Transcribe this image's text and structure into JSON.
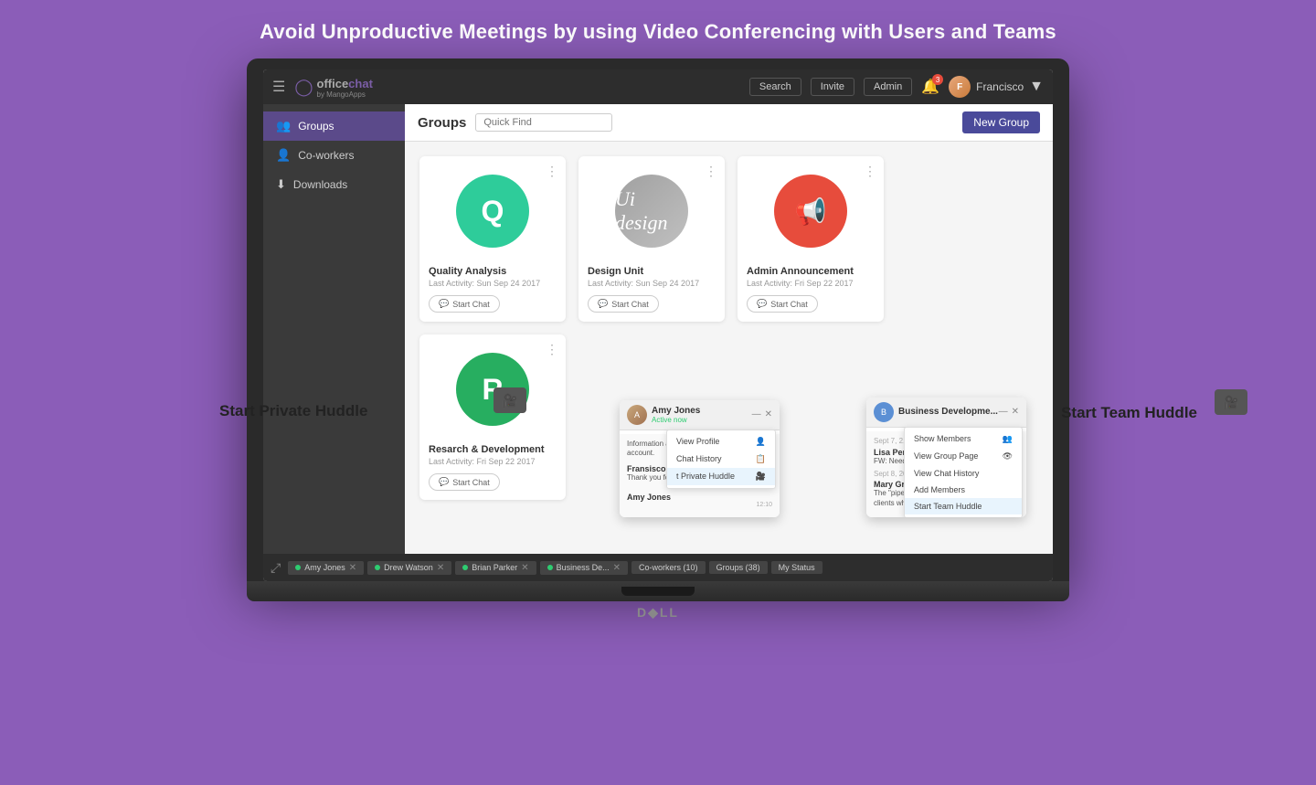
{
  "headline": "Avoid Unproductive Meetings by using Video Conferencing with Users and Teams",
  "nav": {
    "search_label": "Search",
    "invite_label": "Invite",
    "admin_label": "Admin",
    "user_name": "Francisco",
    "logo_office": "office",
    "logo_chat": "chat",
    "logo_sub": "by MangoApps"
  },
  "sidebar": {
    "items": [
      {
        "label": "Groups",
        "icon": "👥",
        "active": true
      },
      {
        "label": "Co-workers",
        "icon": "👤",
        "active": false
      },
      {
        "label": "Downloads",
        "icon": "⬇",
        "active": false
      }
    ]
  },
  "groups_section": {
    "title": "Groups",
    "quick_find_placeholder": "Quick Find",
    "new_group_label": "New Group"
  },
  "groups": [
    {
      "name": "Quality Analysis",
      "activity": "Last Activity: Sun Sep 24 2017",
      "avatar_letter": "Q",
      "avatar_color": "teal",
      "start_chat": "Start Chat"
    },
    {
      "name": "Design Unit",
      "activity": "Last Activity: Sun Sep 24 2017",
      "avatar_type": "image",
      "avatar_text": "Ui design",
      "start_chat": "Start Chat"
    },
    {
      "name": "Admin Announcement",
      "activity": "Last Activity: Fri Sep 22 2017",
      "avatar_letter": "📢",
      "avatar_color": "red",
      "start_chat": "Start Chat"
    },
    {
      "name": "Resarch & Development",
      "activity": "Last Activity: Fri Sep 22 2017",
      "avatar_letter": "R",
      "avatar_color": "green",
      "start_chat": "Start Chat"
    }
  ],
  "bottom_tabs": [
    {
      "label": "Amy Jones",
      "has_dot": true
    },
    {
      "label": "Drew Watson",
      "has_dot": true
    },
    {
      "label": "Brian Parker",
      "has_dot": true
    },
    {
      "label": "Business De...",
      "has_dot": true
    },
    {
      "label": "Co-workers (10)",
      "has_dot": false
    },
    {
      "label": "Groups (38)",
      "has_dot": false
    },
    {
      "label": "My Status",
      "has_dot": false
    }
  ],
  "huddle": {
    "private_label": "Start Private Huddle",
    "team_label": "Start Team Huddle"
  },
  "amy_chat": {
    "name": "Amy Jones",
    "status": "Active now",
    "menu_items": [
      "View Profile",
      "Chat History",
      "t Private Huddle"
    ],
    "messages": [
      {
        "sender": "",
        "text": "Information about your Cloud Service account.",
        "time": ""
      },
      {
        "sender": "Fransisco",
        "text": "Thank you for the service provided.",
        "time": "12:10"
      },
      {
        "sender": "Amy Jones",
        "text": "",
        "time": "12:10"
      }
    ]
  },
  "business_chat": {
    "name": "Business Developme...",
    "menu_items": [
      "Show Members",
      "View Group Page",
      "View Chat History",
      "Add Members",
      "Start Team Huddle"
    ],
    "messages": [
      {
        "date": "Sept 7, 2...",
        "sender": "Lisa Per",
        "text": "FW: Need reports please."
      },
      {
        "date": "Sept 8, 2017",
        "sender": "Mary Greens",
        "text": "The \"pipeline\" refers to flow of potential clients which a company has started..."
      }
    ]
  },
  "dell_logo": "D⬡LL"
}
